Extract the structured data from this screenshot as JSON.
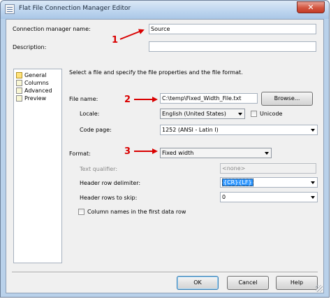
{
  "window": {
    "title": "Flat File Connection Manager Editor",
    "close_glyph": "✕"
  },
  "connection_name": {
    "label": "Connection manager name:",
    "value": "Source"
  },
  "description": {
    "label": "Description:",
    "value": ""
  },
  "nav": {
    "items": [
      {
        "label": "General",
        "icon": "general-page-icon",
        "selected": true
      },
      {
        "label": "Columns",
        "icon": "columns-page-icon",
        "selected": false
      },
      {
        "label": "Advanced",
        "icon": "advanced-page-icon",
        "selected": false
      },
      {
        "label": "Preview",
        "icon": "preview-page-icon",
        "selected": false
      }
    ]
  },
  "instructions": "Select a file and specify the file properties and the file format.",
  "file_name": {
    "label": "File name:",
    "value": "C:\\temp\\Fixed_Width_File.txt",
    "browse_label": "Browse..."
  },
  "locale": {
    "label": "Locale:",
    "value": "English (United States)",
    "unicode_label": "Unicode",
    "unicode_checked": false
  },
  "code_page": {
    "label": "Code page:",
    "value": "1252  (ANSI - Latin I)"
  },
  "format": {
    "label": "Format:",
    "value": "Fixed width"
  },
  "text_qualifier": {
    "label": "Text qualifier:",
    "value": "<none>"
  },
  "header_row_delimiter": {
    "label": "Header row delimiter:",
    "value": "{CR}{LF}"
  },
  "header_rows_to_skip": {
    "label": "Header rows to skip:",
    "value": "0"
  },
  "column_names": {
    "label": "Column names in the first data row",
    "checked": false
  },
  "buttons": {
    "ok": "OK",
    "cancel": "Cancel",
    "help": "Help"
  },
  "annotations": {
    "n1": "1",
    "n2": "2",
    "n3": "3",
    "color": "#d90000"
  },
  "colors": {
    "selection": "#3399ff",
    "title_bar": "#bcd4ee",
    "close_button": "#d2553f"
  }
}
